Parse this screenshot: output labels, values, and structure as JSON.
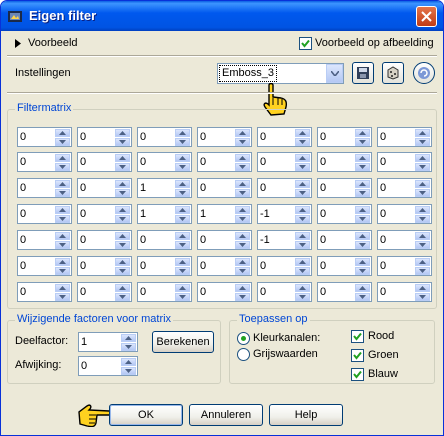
{
  "window": {
    "title": "Eigen filter"
  },
  "preview": {
    "toggle_label": "Voorbeeld",
    "checkbox_label": "Voorbeeld op afbeelding",
    "checked": true
  },
  "settings": {
    "label": "Instellingen",
    "preset_value": "Emboss_3"
  },
  "filter_matrix": {
    "title": "Filtermatrix",
    "rows": [
      [
        "0",
        "0",
        "0",
        "0",
        "0",
        "0",
        "0"
      ],
      [
        "0",
        "0",
        "0",
        "0",
        "0",
        "0",
        "0"
      ],
      [
        "0",
        "0",
        "1",
        "0",
        "0",
        "0",
        "0"
      ],
      [
        "0",
        "0",
        "1",
        "1",
        "-1",
        "0",
        "0"
      ],
      [
        "0",
        "0",
        "0",
        "0",
        "-1",
        "0",
        "0"
      ],
      [
        "0",
        "0",
        "0",
        "0",
        "0",
        "0",
        "0"
      ],
      [
        "0",
        "0",
        "0",
        "0",
        "0",
        "0",
        "0"
      ]
    ]
  },
  "factors": {
    "title": "Wijzigende factoren voor matrix",
    "divisor_label": "Deelfactor:",
    "divisor_value": "1",
    "bias_label": "Afwijking:",
    "bias_value": "0",
    "compute_button": "Berekenen"
  },
  "apply_to": {
    "title": "Toepassen op",
    "mode_color_label": "Kleurkanalen:",
    "mode_gray_label": "Grijswaarden",
    "selected_mode": "color",
    "channels": [
      {
        "label": "Rood",
        "checked": true
      },
      {
        "label": "Groen",
        "checked": true
      },
      {
        "label": "Blauw",
        "checked": true
      }
    ]
  },
  "buttons": {
    "ok": "OK",
    "cancel": "Annuleren",
    "help": "Help"
  },
  "colors": {
    "title_bar": "#0054e3",
    "dialog_bg": "#ece9d8",
    "group_title": "#0046d5",
    "checkmark": "#21a121"
  },
  "icons": [
    "program-icon",
    "close-icon",
    "triangle-right-icon",
    "save-preset-icon",
    "load-preset-icon",
    "reset-icon",
    "pointing-hand-icon"
  ]
}
